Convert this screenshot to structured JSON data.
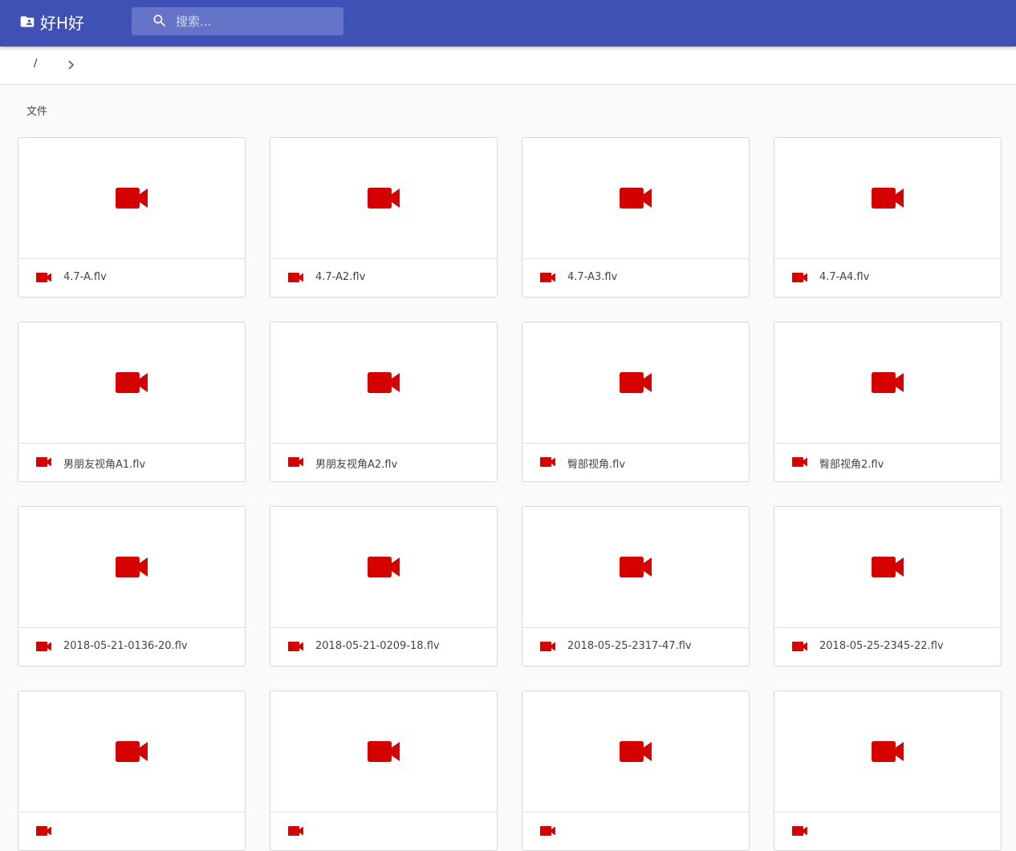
{
  "header": {
    "brand_icon": "folder-account-icon",
    "brand_name": "好H好",
    "search_icon": "search-icon",
    "search_placeholder": "搜索..."
  },
  "breadcrumb": {
    "root": "/",
    "separator_icon": "chevron-right-icon"
  },
  "section_label": "文件",
  "colors": {
    "app_bar": "#3f51b5",
    "video_icon": "#d50000"
  },
  "files": [
    {
      "name": "4.7-A.flv",
      "icon": "video-camera-icon"
    },
    {
      "name": "4.7-A2.flv",
      "icon": "video-camera-icon"
    },
    {
      "name": "4.7-A3.flv",
      "icon": "video-camera-icon"
    },
    {
      "name": "4.7-A4.flv",
      "icon": "video-camera-icon"
    },
    {
      "name": "男朋友视角A1.flv",
      "icon": "video-camera-icon"
    },
    {
      "name": "男朋友视角A2.flv",
      "icon": "video-camera-icon"
    },
    {
      "name": "臀部视角.flv",
      "icon": "video-camera-icon"
    },
    {
      "name": "臀部视角2.flv",
      "icon": "video-camera-icon"
    },
    {
      "name": "2018-05-21-0136-20.flv",
      "icon": "video-camera-icon"
    },
    {
      "name": "2018-05-21-0209-18.flv",
      "icon": "video-camera-icon"
    },
    {
      "name": "2018-05-25-2317-47.flv",
      "icon": "video-camera-icon"
    },
    {
      "name": "2018-05-25-2345-22.flv",
      "icon": "video-camera-icon"
    },
    {
      "name": "",
      "icon": "video-camera-icon"
    },
    {
      "name": "",
      "icon": "video-camera-icon"
    },
    {
      "name": "",
      "icon": "video-camera-icon"
    },
    {
      "name": "",
      "icon": "video-camera-icon"
    }
  ]
}
